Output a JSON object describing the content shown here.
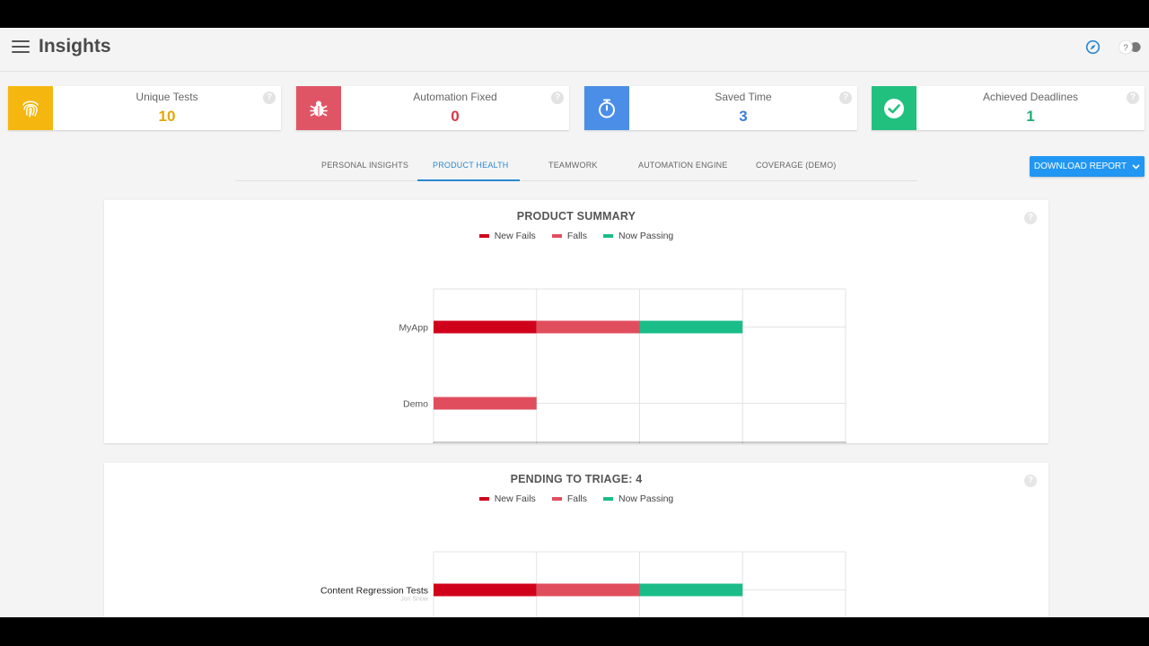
{
  "header": {
    "title": "Insights"
  },
  "colors": {
    "new_fails": "#d0021b",
    "fails": "#e04e5e",
    "now_passing": "#1abc88",
    "accent": "#2b8ad0"
  },
  "stats": [
    {
      "label": "Unique Tests",
      "value": "10",
      "icon": "fingerprint-icon",
      "tile_color": "#f5b60f",
      "value_color": "#e6a700"
    },
    {
      "label": "Automation Fixed",
      "value": "0",
      "icon": "bug-icon",
      "tile_color": "#e05566",
      "value_color": "#d9374b"
    },
    {
      "label": "Saved Time",
      "value": "3",
      "icon": "stopwatch-icon",
      "tile_color": "#4a8ee8",
      "value_color": "#3d7fd9"
    },
    {
      "label": "Achieved Deadlines",
      "value": "1",
      "icon": "check-circle-icon",
      "tile_color": "#22c07f",
      "value_color": "#1fae72"
    }
  ],
  "tabs": [
    {
      "label": "PERSONAL INSIGHTS"
    },
    {
      "label": "PRODUCT HEALTH",
      "active": true
    },
    {
      "label": "TEAMWORK"
    },
    {
      "label": "AUTOMATION ENGINE"
    },
    {
      "label": "COVERAGE (DEMO)"
    }
  ],
  "download": {
    "label": "DOWNLOAD REPORT"
  },
  "legend": {
    "new_fails": "New Fails",
    "fails": "Falls",
    "now_passing": "Now Passing"
  },
  "chart_data": [
    {
      "type": "bar",
      "orientation": "horizontal",
      "stacked": true,
      "title": "PRODUCT SUMMARY",
      "categories": [
        "MyApp",
        "Demo"
      ],
      "series": [
        {
          "name": "New Fails",
          "values": [
            1,
            0
          ]
        },
        {
          "name": "Falls",
          "values": [
            1,
            1
          ]
        },
        {
          "name": "Now Passing",
          "values": [
            1,
            0
          ]
        }
      ],
      "xlim": [
        0,
        4
      ],
      "xticks": [
        0,
        1,
        2,
        3,
        4
      ],
      "grid": true,
      "legend": "top-center"
    },
    {
      "type": "bar",
      "orientation": "horizontal",
      "stacked": true,
      "title": "PENDING TO TRIAGE: 4",
      "categories": [
        "Content Regression Tests"
      ],
      "category_sublabels": [
        "Jon Snow"
      ],
      "series": [
        {
          "name": "New Fails",
          "values": [
            1
          ]
        },
        {
          "name": "Falls",
          "values": [
            1
          ]
        },
        {
          "name": "Now Passing",
          "values": [
            1
          ]
        }
      ],
      "xlim": [
        0,
        4
      ],
      "grid": true,
      "legend": "top-center"
    }
  ]
}
